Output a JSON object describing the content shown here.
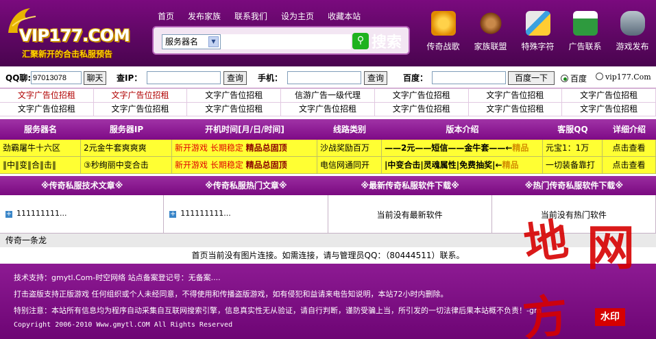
{
  "header": {
    "logo_text": "VIP177.COM",
    "slogan": "汇聚新开的合击私服预告",
    "nav": [
      "首页",
      "发布家族",
      "联系我们",
      "设为主页",
      "收藏本站"
    ],
    "search_select": "服务器名",
    "search_button": "搜索",
    "quick_links": [
      {
        "label": "传奇战歌",
        "icon": "gears-icon",
        "color": "#f0a000"
      },
      {
        "label": "家族联盟",
        "icon": "ship-wheel-icon",
        "color": "#8a4a1a"
      },
      {
        "label": "特殊字符",
        "icon": "pencil-tools-icon",
        "color": "#3aa0e0"
      },
      {
        "label": "广告联系",
        "icon": "id-card-icon",
        "color": "#2e9a3e"
      },
      {
        "label": "游戏发布",
        "icon": "gamepad-icon",
        "color": "#5a6a7a"
      }
    ]
  },
  "toolbar": {
    "qq_label": "QQ聊:",
    "qq_value": "97013078",
    "chat_button": "聊天",
    "ip_label": "查IP：",
    "ip_button": "查询",
    "phone_label": "手机：",
    "phone_button": "查询",
    "baidu_label": "百度：",
    "baidu_button": "百度一下",
    "radio_baidu": "百度",
    "radio_site": "vip177.Com"
  },
  "ads": [
    "文字广告位招租",
    "文字广告位招租",
    "文字广告位招租",
    "信游广告一级代理",
    "文字广告位招租",
    "文字广告位招租",
    "文字广告位招租",
    "文字广告位招租",
    "文字广告位招租",
    "文字广告位招租",
    "文字广告位招租",
    "文字广告位招租",
    "文字广告位招租",
    "文字广告位招租"
  ],
  "server_table": {
    "headers": [
      "服务器名",
      "服务器IP",
      "开机时间[月/日/时间]",
      "线路类别",
      "版本介绍",
      "客服QQ",
      "详细介绍"
    ],
    "rows": [
      {
        "name": "劲霸屠牛十六区",
        "ip": "2元金牛套爽爽爽",
        "time_a": "新开游戏 长期稳定",
        "time_b": "精品总固顶",
        "line": "沙战奖励百万",
        "ver_a": "——2元——短信——金牛套——←",
        "ver_b": "精品",
        "qq": "元宝1：1万",
        "detail": "点击查看"
      },
      {
        "name": "‖中‖变‖合‖击‖",
        "ip": "③秒绚丽中变合击",
        "time_a": "新开游戏 长期稳定",
        "time_b": "精品总固顶",
        "line": "电信网通同开",
        "ver_a": "|中变合击|灵魂属性|免费抽奖|←",
        "ver_b": "精品",
        "qq": "一切装备靠打",
        "detail": "点击查看"
      }
    ]
  },
  "articles": {
    "headers": [
      "※传奇私服技术文章※",
      "※传奇私服热门文章※",
      "※最新传奇私服软件下载※",
      "※热门传奇私服软件下载※"
    ],
    "col1_link": "111111111...",
    "col2_link": "111111111...",
    "col3_text": "当前没有最新软件",
    "col4_text": "当前没有热门软件"
  },
  "friend_link": "传奇一条龙",
  "image_note": "首页当前没有图片连接。如需连接，请与管理员QQ：（80444511）联系。",
  "footer": {
    "line1": "技术支持：gmytl.Com-时空网络 站点备案登记号：无备案....",
    "line2": "打击盗版支持正版游戏 任何组织或个人未经同意，不得使用和传播盗版游戏，如有侵犯和益请来电告知说明，本站72小时内删除。",
    "line3": "特别注意：本站所有信息均为程序自动采集自互联网搜索引擎，信息真实性无从验证，请自行判断，谨防受骗上当，所引发的一切法律后果本站概不负责！-gm",
    "line4": "Copyright 2006-2010 Www.gmytl.COM All Rights Reserved"
  },
  "watermark": {
    "chars": [
      "地",
      "网",
      "方"
    ],
    "seal": "水印"
  }
}
